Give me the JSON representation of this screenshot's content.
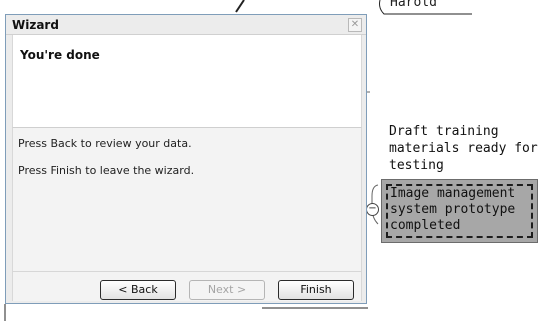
{
  "wizard": {
    "title": "Wizard",
    "close_symbol": "✕",
    "header_title": "You're done",
    "body_lines": [
      "Press Back to review your data.",
      "Press Finish to leave the wizard."
    ],
    "buttons": {
      "back": "< Back",
      "next": "Next >",
      "finish": "Finish"
    }
  },
  "mindmap": {
    "top_node": "Harold",
    "draft_node": "Draft training materials ready for testing",
    "image_node": "Image management system prototype completed",
    "collapse_symbol": "−"
  }
}
